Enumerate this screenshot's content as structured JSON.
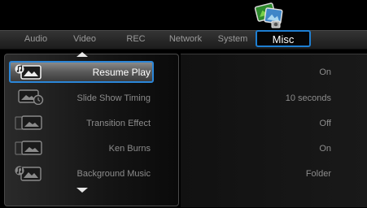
{
  "tabs": [
    {
      "label": "Audio"
    },
    {
      "label": "Video"
    },
    {
      "label": "REC"
    },
    {
      "label": "Network"
    },
    {
      "label": "System"
    },
    {
      "label": "Misc"
    }
  ],
  "active_tab_index": 5,
  "settings": [
    {
      "label": "Resume Play",
      "value": "On",
      "icon": "photo-music-icon",
      "selected": true
    },
    {
      "label": "Slide Show Timing",
      "value": "10 seconds",
      "icon": "photo-clock-icon",
      "selected": false
    },
    {
      "label": "Transition Effect",
      "value": "Off",
      "icon": "photo-transition-icon",
      "selected": false
    },
    {
      "label": "Ken Burns",
      "value": "On",
      "icon": "photo-transition-icon",
      "selected": false
    },
    {
      "label": "Background Music",
      "value": "Folder",
      "icon": "photo-music-icon",
      "selected": false
    }
  ],
  "colors": {
    "accent": "#2b86d8",
    "background": "#000000",
    "text_dim": "#8c8c8c",
    "text_bright": "#ffffff"
  }
}
